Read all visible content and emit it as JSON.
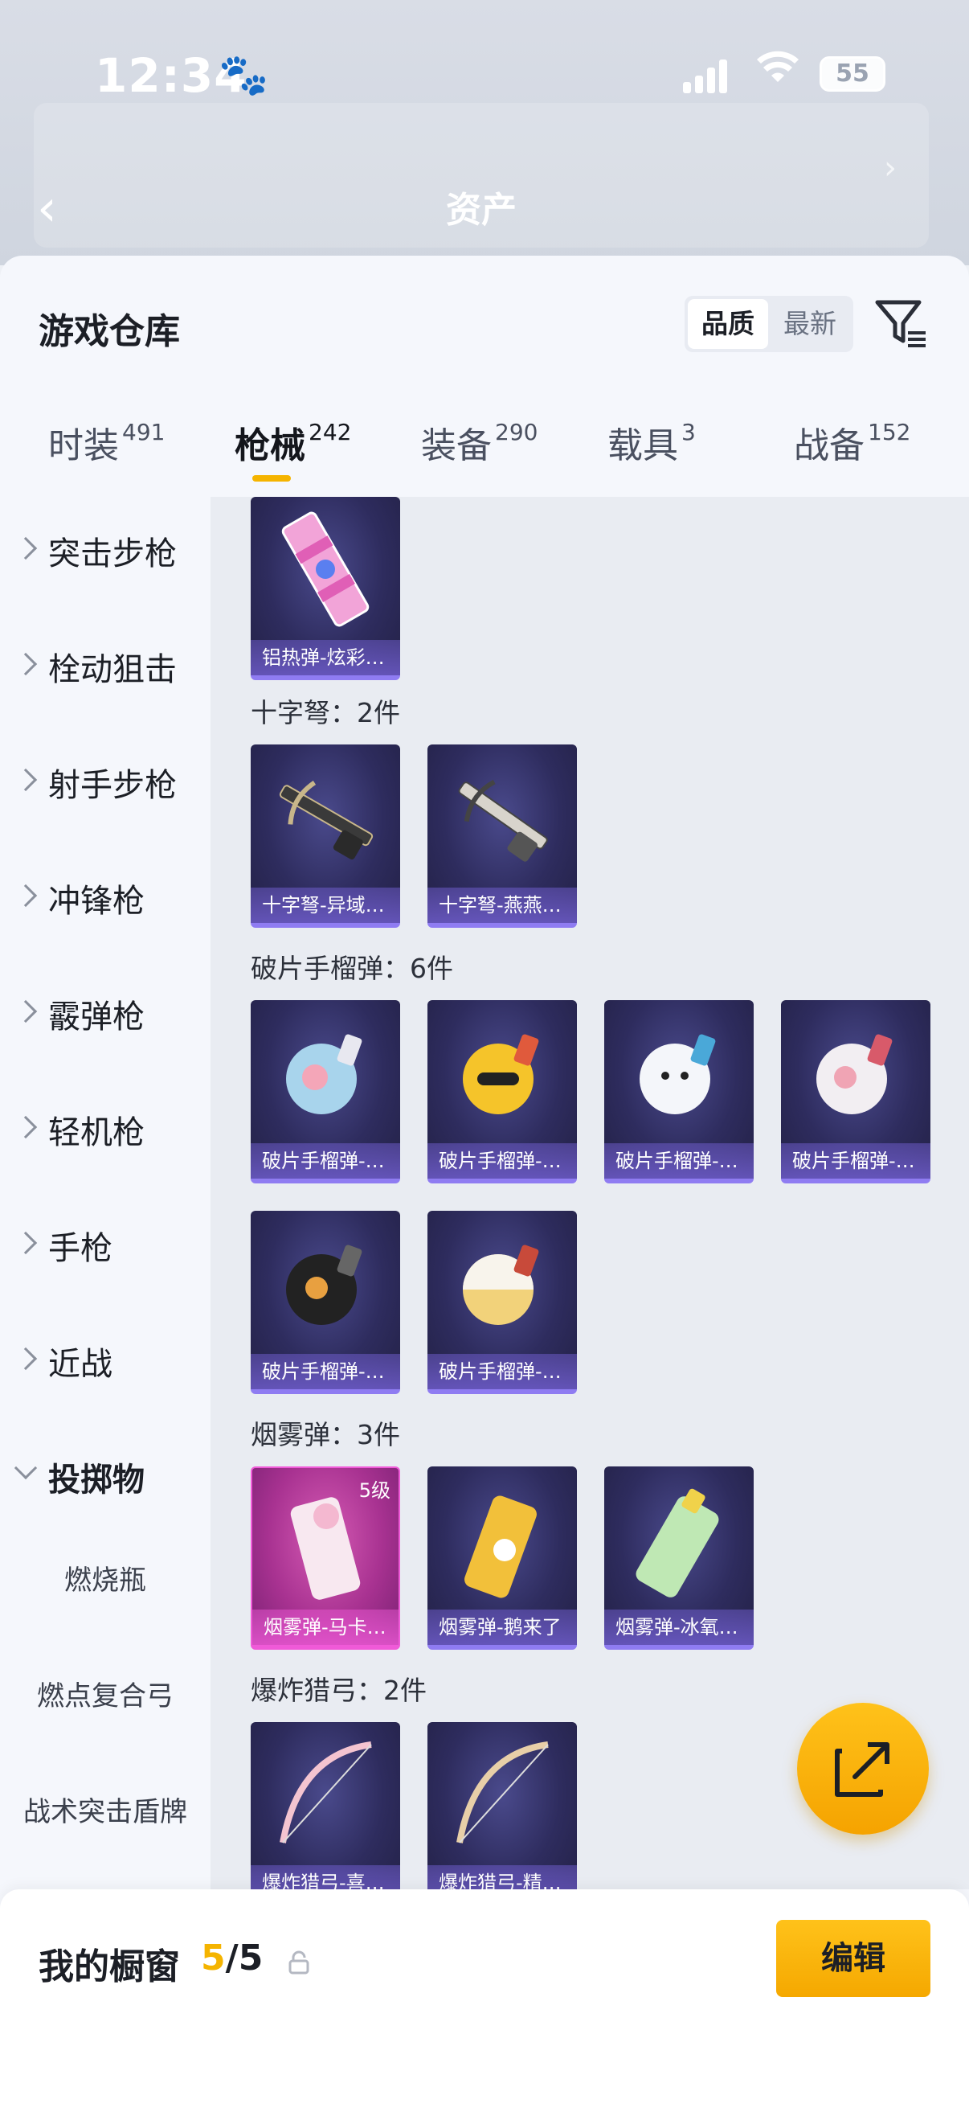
{
  "status_bar": {
    "time": "12:34",
    "battery": "55"
  },
  "header": {
    "title": "资产"
  },
  "sheet": {
    "title": "游戏仓库",
    "sort_options": [
      "品质",
      "最新"
    ]
  },
  "tabs": [
    {
      "label": "时装",
      "count": "491"
    },
    {
      "label": "枪械",
      "count": "242"
    },
    {
      "label": "装备",
      "count": "290"
    },
    {
      "label": "载具",
      "count": "3"
    },
    {
      "label": "战备",
      "count": "152"
    }
  ],
  "categories": [
    "突击步枪",
    "栓动狙击",
    "射手步枪",
    "冲锋枪",
    "霰弹枪",
    "轻机枪",
    "手枪",
    "近战",
    "投掷物"
  ],
  "subcategories": [
    "燃烧瓶",
    "燃点复合弓",
    "战术突击盾牌"
  ],
  "sections": [
    {
      "label": "",
      "items": [
        {
          "name": "铝热弹-炫彩…"
        }
      ]
    },
    {
      "label": "十字弩：2件",
      "items": [
        {
          "name": "十字弩-异域…"
        },
        {
          "name": "十字弩-燕燕…"
        }
      ]
    },
    {
      "label": "破片手榴弹：6件",
      "items": [
        {
          "name": "破片手榴弹-…"
        },
        {
          "name": "破片手榴弹-…"
        },
        {
          "name": "破片手榴弹-…"
        },
        {
          "name": "破片手榴弹-…"
        },
        {
          "name": "破片手榴弹-…"
        },
        {
          "name": "破片手榴弹-…"
        }
      ]
    },
    {
      "label": "烟雾弹：3件",
      "items": [
        {
          "name": "烟雾弹-马卡…",
          "level": "5级"
        },
        {
          "name": "烟雾弹-鹅来了"
        },
        {
          "name": "烟雾弹-冰氧…"
        }
      ]
    },
    {
      "label": "爆炸猎弓：2件",
      "items": [
        {
          "name": "爆炸猎弓-喜…"
        },
        {
          "name": "爆炸猎弓-精…"
        }
      ]
    }
  ],
  "bottom_bar": {
    "title": "我的橱窗",
    "count_current": "5",
    "count_sep": "/5",
    "edit_label": "编辑"
  },
  "colors": {
    "accent": "#f5b400",
    "card_border": "#8f7cf2",
    "pink_rarity": "#f05ad8"
  }
}
